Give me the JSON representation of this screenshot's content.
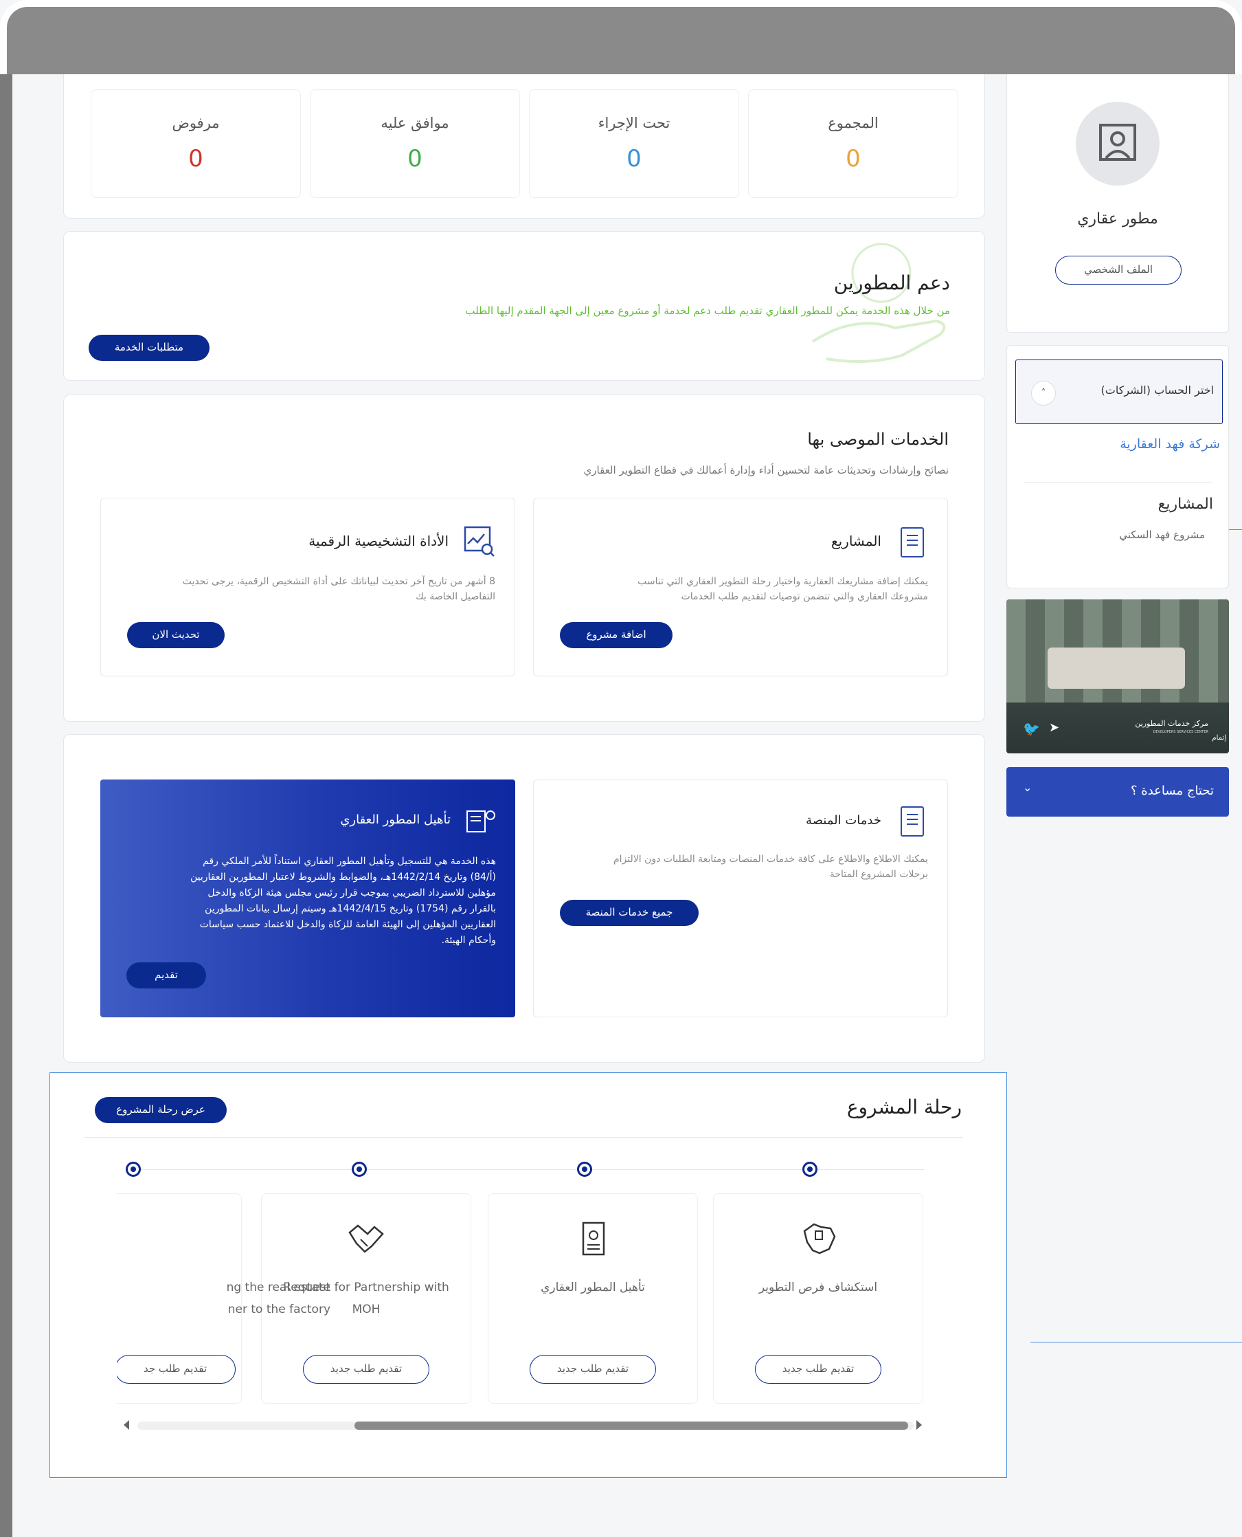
{
  "stats": [
    {
      "label": "مرفوض",
      "value": "0",
      "color": "#d0342c"
    },
    {
      "label": "موافق عليه",
      "value": "0",
      "color": "#3fae49"
    },
    {
      "label": "تحت الإجراء",
      "value": "0",
      "color": "#3a8fd9"
    },
    {
      "label": "المجموع",
      "value": "0",
      "color": "#e8a33b"
    }
  ],
  "dev_support": {
    "title": "دعم المطورين",
    "desc": "من خلال هذه الخدمة يمكن للمطور العقاري تقديم طلب دعم لخدمة أو مشروع معين إلى الجهة المقدم إليها الطلب",
    "button": "متطلبات الخدمة"
  },
  "recommended": {
    "title": "الخدمات الموصى بها",
    "subtitle": "نصائح وإرشادات وتحديثات عامة لتحسين أداء وإدارة أعمالك في قطاع التطوير العقاري",
    "projects": {
      "title": "المشاريع",
      "desc": "يمكنك إضافة مشاريعك العقارية واختيار رحلة التطوير العقاري التي تناسب مشروعك العقاري والتي تتضمن توصيات لتقديم طلب الخدمات",
      "button": "اضافة مشروع"
    },
    "diagnostic": {
      "title": "الأداة التشخيصية الرقمية",
      "desc": "8 أشهر من تاريخ آخر تحديث لبياناتك على أداة التشخيص الرقمية، يرجى تحديث التفاصيل الخاصة بك",
      "button": "تحديث الان"
    }
  },
  "platform": {
    "title": "خدمات المنصة",
    "desc": "يمكنك الاطلاع والاطلاع على كافة خدمات المنصات ومتابعة الطلبات دون الالتزام برحلات المشروع المتاحة",
    "button": "جميع خدمات المنصة"
  },
  "qualification": {
    "title": "تأهيل المطور العقاري",
    "desc": "هذه الخدمة هي للتسجيل وتأهيل المطور العقاري استناداً للأمر الملكي رقم (أ/84) وتاريخ 1442/2/14هـ، والضوابط والشروط لاعتبار المطورين العقاريين مؤهلين للاسترداد الضريبي بموجب قرار رئيس مجلس هيئة الزكاة والدخل بالقرار رقم (1754) وتاريخ 1442/4/15هـ وسيتم إرسال بيانات المطورين العقاريين المؤهلين إلى الهيئة العامة للزكاة والدخل للاعتماد حسب سياسات وأحكام الهيئة.",
    "button": "تقديم"
  },
  "journey": {
    "title": "رحلة المشروع",
    "button": "عرض رحلة المشروع",
    "steps": [
      {
        "title": "استكشاف فرص التطوير",
        "button": "تقديم طلب جديد",
        "icon": "saudi-map-icon"
      },
      {
        "title": "تأهيل المطور العقاري",
        "button": "تقديم طلب جديد",
        "icon": "document-certificate-icon"
      },
      {
        "title": "Request for Partnership with MOH",
        "button": "تقديم طلب جديد",
        "icon": "handshake-icon"
      },
      {
        "title": "ng the real estate\nner to the factory",
        "button": "تقديم طلب جد",
        "icon": ""
      }
    ]
  },
  "profile": {
    "name": "مطور عقاري",
    "button": "الملف الشخصي"
  },
  "account": {
    "select_label": "اختر الحساب (الشركات)",
    "company": "شركة فهد العقارية",
    "projects_title": "المشاريع",
    "project": "مشروع فهد السكني"
  },
  "banner": {
    "caption": "مركز خدمات المطورين",
    "caption_en": "DEVELOPERS SERVICES CENTER",
    "tag": "إتمام"
  },
  "help": {
    "label": "تحتاج مساعدة ؟"
  },
  "colors": {
    "primary": "#0b2a8f",
    "green": "#5bbf2f"
  }
}
